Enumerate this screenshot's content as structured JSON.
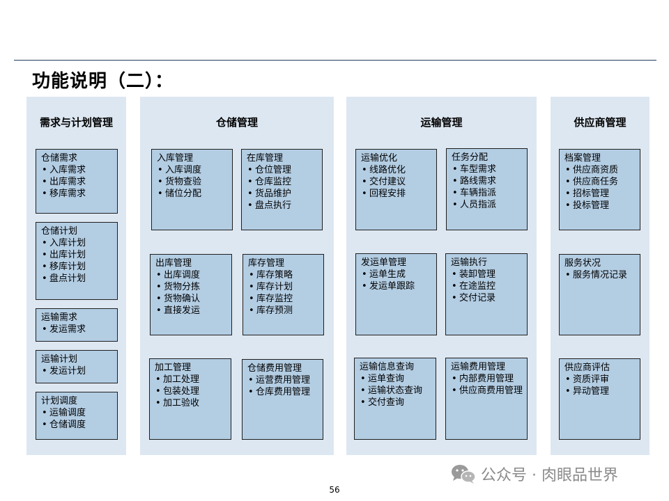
{
  "title": "功能说明（二）：",
  "columns": [
    {
      "heading": "需求与计划管理",
      "boxes": [
        {
          "title": "仓储需求",
          "items": [
            "入库需求",
            "出库需求",
            "移库需求"
          ]
        },
        {
          "title": "仓储计划",
          "items": [
            "入库计划",
            "出库计划",
            "移库计划",
            "盘点计划"
          ]
        },
        {
          "title": "运输需求",
          "items": [
            "发运需求"
          ]
        },
        {
          "title": "运输计划",
          "items": [
            "发运计划"
          ]
        },
        {
          "title": "计划调度",
          "items": [
            "运输调度",
            "仓储调度"
          ]
        }
      ]
    },
    {
      "heading": "仓储管理",
      "boxes": [
        {
          "title": "入库管理",
          "items": [
            "入库调度",
            "货物查验",
            "储位分配"
          ]
        },
        {
          "title": "在库管理",
          "items": [
            "仓位管理",
            "仓库监控",
            "货品维护",
            "盘点执行"
          ]
        },
        {
          "title": "出库管理",
          "items": [
            "出库调度",
            "货物分拣",
            "货物确认",
            "直接发运"
          ]
        },
        {
          "title": "库存管理",
          "items": [
            "库存策略",
            "库存计划",
            "库存监控",
            "库存预测"
          ]
        },
        {
          "title": "加工管理",
          "items": [
            "加工处理",
            "包装处理",
            "加工验收"
          ]
        },
        {
          "title": "仓储费用管理",
          "items": [
            "运营费用管理",
            "仓库费用管理"
          ]
        }
      ]
    },
    {
      "heading": "运输管理",
      "boxes": [
        {
          "title": "运输优化",
          "items": [
            "线路优化",
            "交付建议",
            "回程安排"
          ]
        },
        {
          "title": "任务分配",
          "items": [
            "车型需求",
            "路线需求",
            "车辆指派",
            "人员指派"
          ]
        },
        {
          "title": "发运单管理",
          "items": [
            "运单生成",
            "发运单跟踪"
          ]
        },
        {
          "title": "运输执行",
          "items": [
            "装卸管理",
            "在途监控",
            "交付记录"
          ]
        },
        {
          "title": "运输信息查询",
          "items": [
            "运单查询",
            "运输状态查询",
            "交付查询"
          ]
        },
        {
          "title": "运输费用管理",
          "items": [
            "内部费用管理",
            "供应商费用管理"
          ]
        }
      ]
    },
    {
      "heading": "供应商管理",
      "boxes": [
        {
          "title": "档案管理",
          "items": [
            "供应商资质",
            "供应商任务",
            "招标管理",
            "投标管理"
          ]
        },
        {
          "title": "服务状况",
          "items": [
            "服务情况记录"
          ]
        },
        {
          "title": "供应商评估",
          "items": [
            "资质评审",
            "异动管理"
          ]
        }
      ]
    }
  ],
  "watermark": {
    "text": "公众号 · 肉眼品世界",
    "icon": "wechat-icon"
  },
  "page_number": "56",
  "colors": {
    "panel": "#dde7f1",
    "box": "#b3cde3",
    "rule": "#1f3a5a"
  }
}
